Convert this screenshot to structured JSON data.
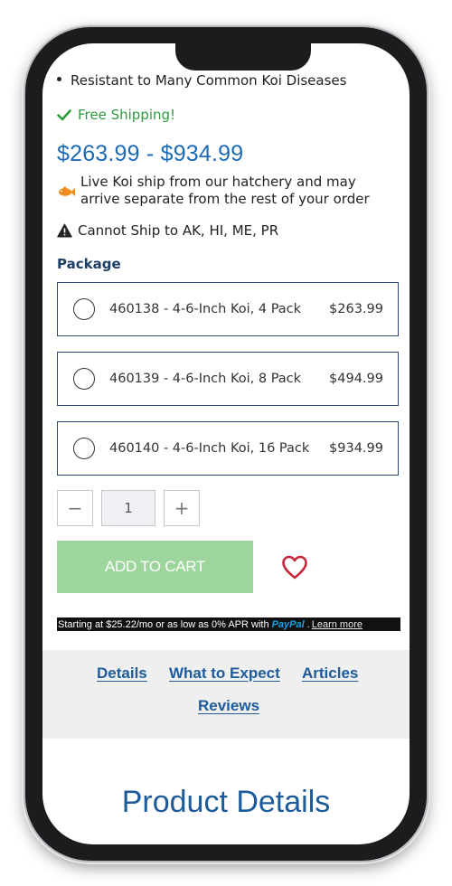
{
  "features": {
    "bullet": "Resistant to Many Common Koi Diseases"
  },
  "shipping": {
    "free_label": "Free Shipping!",
    "live_note": "Live Koi ship from our hatchery and may arrive separate from the rest of your order",
    "restriction": "Cannot Ship to AK, HI, ME, PR"
  },
  "price_range": "$263.99 - $934.99",
  "package": {
    "label": "Package",
    "options": [
      {
        "name": "460138 - 4-6-Inch Koi, 4 Pack",
        "price": "$263.99",
        "selected": false
      },
      {
        "name": "460139 - 4-6-Inch Koi, 8 Pack",
        "price": "$494.99",
        "selected": false
      },
      {
        "name": "460140 - 4-6-Inch Koi, 16 Pack",
        "price": "$934.99",
        "selected": false
      }
    ]
  },
  "quantity": {
    "minus": "−",
    "value": "1",
    "plus": "+"
  },
  "add_to_cart_label": "ADD TO CART",
  "paypal": {
    "text": "Starting at $25.22/mo or as low as 0% APR with",
    "brand_pay": "Pay",
    "brand_pal": "Pal",
    "period": ".",
    "link": "Learn more"
  },
  "tabs": [
    "Details",
    "What to Expect",
    "Articles",
    "Reviews"
  ],
  "section_title": "Product Details",
  "colors": {
    "accent_blue": "#1d6bb5",
    "free_shipping_green": "#2e9b3e",
    "cart_button": "#9dd59d",
    "heart": "#c8283c",
    "fish": "#f28b1e"
  },
  "icons": {
    "check": "check-icon",
    "fish": "fish-icon",
    "warning": "warning-icon",
    "heart": "heart-icon"
  }
}
